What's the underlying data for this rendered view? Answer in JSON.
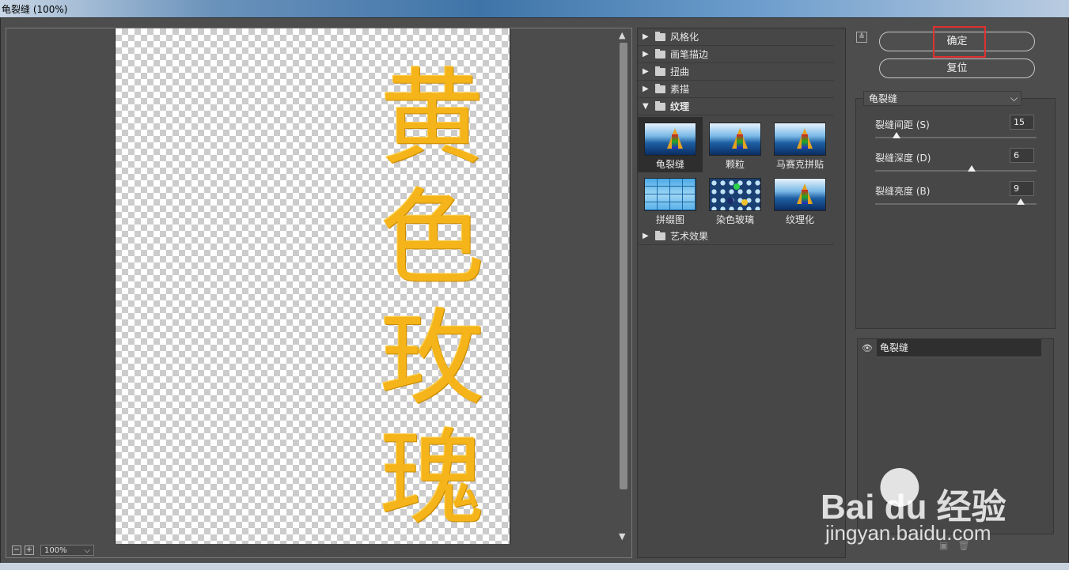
{
  "window": {
    "title": "龟裂缝 (100%)"
  },
  "preview": {
    "text_chars": [
      "黄",
      "色",
      "玫",
      "瑰"
    ],
    "zoom": "100%",
    "zoom_out": "−",
    "zoom_in": "+",
    "text_color": "#f4b41a"
  },
  "filter_gallery": {
    "categories_top": [
      "风格化",
      "画笔描边",
      "扭曲",
      "素描"
    ],
    "open_category": "纹理",
    "thumbnails": [
      {
        "label": "龟裂缝",
        "selected": true,
        "icon": "sailboat-thumbnail"
      },
      {
        "label": "颗粒",
        "selected": false,
        "icon": "sailboat-thumbnail"
      },
      {
        "label": "马赛克拼贴",
        "selected": false,
        "icon": "sailboat-thumbnail"
      },
      {
        "label": "拼缀图",
        "selected": false,
        "icon": "tile-thumbnail"
      },
      {
        "label": "染色玻璃",
        "selected": false,
        "icon": "stained-glass-thumbnail"
      },
      {
        "label": "纹理化",
        "selected": false,
        "icon": "sailboat-thumbnail"
      }
    ],
    "categories_bottom": [
      "艺术效果"
    ]
  },
  "buttons": {
    "ok": "确定",
    "reset": "复位"
  },
  "settings": {
    "filter": "龟裂缝",
    "params": [
      {
        "label": "裂缝间距 (S)",
        "value": "15",
        "min": 2,
        "max": 100
      },
      {
        "label": "裂缝深度 (D)",
        "value": "6",
        "min": 0,
        "max": 10
      },
      {
        "label": "裂缝亮度 (B)",
        "value": "9",
        "min": 0,
        "max": 10
      }
    ]
  },
  "layers": [
    {
      "name": "龟裂缝",
      "visible": true
    }
  ],
  "watermark": {
    "logo": "Bai du 经验",
    "url": "jingyan.baidu.com"
  },
  "colors": {
    "highlight_box": "#e03030",
    "panel_bg": "#474747"
  }
}
